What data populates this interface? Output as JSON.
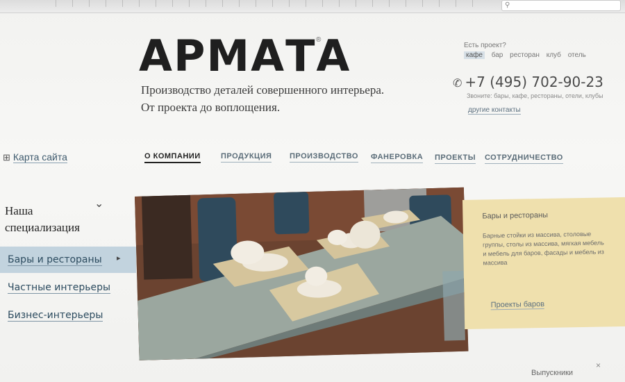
{
  "header": {
    "logo": "АРМАТА",
    "logo_mark": "®",
    "tagline_line1": "Производство деталей совершенного интерьера.",
    "tagline_line2": "От проекта до воплощения."
  },
  "contact": {
    "question": "Есть проект?",
    "categories": [
      "кафе",
      "бар",
      "ресторан",
      "клуб",
      "отель"
    ],
    "phone": "+7 (495) 702-90-23",
    "note": "Звоните: бары, кафе, рестораны, отели, клубы",
    "link": "другие контакты"
  },
  "sitemap": {
    "label": "Карта сайта",
    "icon": "sitemap-icon"
  },
  "nav": {
    "items": [
      "О КОМПАНИИ",
      "ПРОДУКЦИЯ",
      "ПРОИЗВОДСТВО",
      "ФАНЕРОВКА",
      "ПРОЕКТЫ",
      "СОТРУДНИЧЕСТВО"
    ]
  },
  "sidebar": {
    "title_line1": "Наша",
    "title_line2": "специализация",
    "items": [
      "Бары и рестораны",
      "Частные интерьеры",
      "Бизнес-интерьеры"
    ]
  },
  "panel": {
    "title": "Бары и рестораны",
    "text": "Барные стойки из массива, столовые группы, столы из массива, мягкая мебель и мебель для баров, фасады и мебель из массива",
    "link": "Проекты баров"
  },
  "footer": {
    "right_label": "Выпускники"
  },
  "colors": {
    "accent_blue": "#c2d3de",
    "panel_yellow": "#efe0ad",
    "link": "#3e5a6d"
  }
}
